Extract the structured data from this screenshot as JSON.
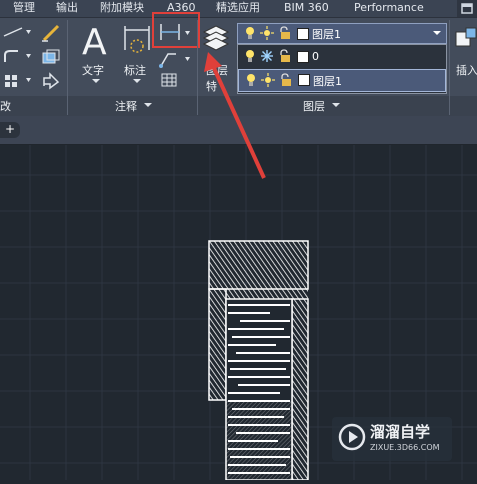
{
  "menu": {
    "items": [
      "管理",
      "输出",
      "附加模块",
      "A360",
      "精选应用",
      "BIM 360",
      "Performance"
    ]
  },
  "ribbon": {
    "left_partial_title": "改",
    "annotation": {
      "title": "注释",
      "text_label": "文字",
      "dimension_label": "标注"
    },
    "layer_props_label_1": "图层",
    "layer_props_label_2": "特",
    "layers": {
      "title": "图层",
      "current": "图层1",
      "options": [
        {
          "name": "0"
        },
        {
          "name": "图层1"
        }
      ]
    },
    "insert_label": "插入"
  },
  "tabs": {
    "add": "+"
  },
  "watermark": {
    "title": "溜溜自学",
    "url": "ZIXUE.3D66.COM"
  },
  "colors": {
    "highlight_box": "#e0403a",
    "arrow": "#e0403a",
    "selection": "#4b5a79"
  }
}
